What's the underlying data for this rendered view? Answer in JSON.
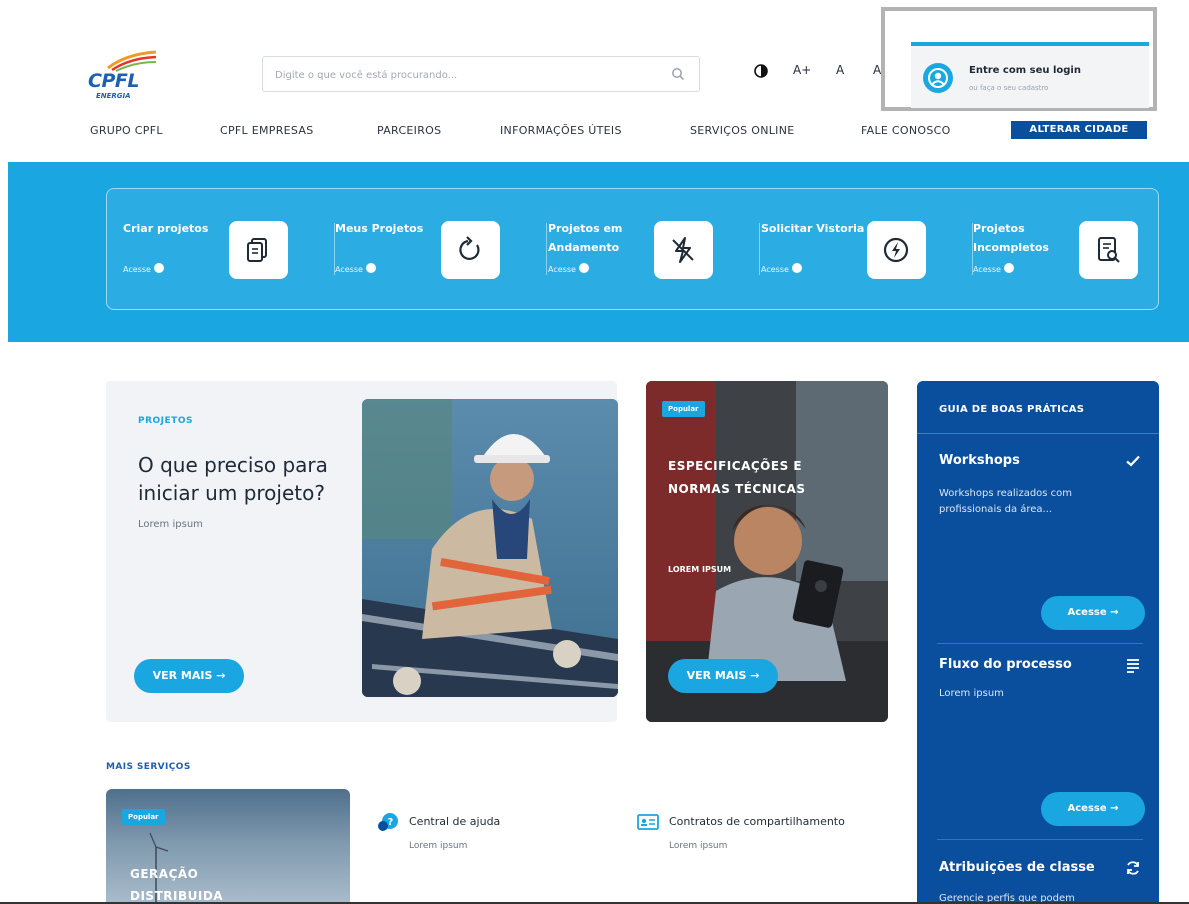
{
  "header": {
    "logo_text": "CPFL",
    "logo_sub": "ENERGIA",
    "search_placeholder": "Digite o que você está procurando...",
    "a11y": {
      "a_plus": "A+",
      "a": "A",
      "a_minus": "A-"
    },
    "login": {
      "title": "Entre com seu login",
      "subtitle": "ou faça o seu cadastro"
    }
  },
  "nav": {
    "items": [
      "GRUPO CPFL",
      "CPFL EMPRESAS",
      "PARCEIROS",
      "INFORMAÇÕES ÚTEIS",
      "SERVIÇOS ONLINE",
      "FALE CONOSCO"
    ],
    "cta": "ALTERAR CIDADE"
  },
  "actions": [
    {
      "label": "Criar projetos",
      "link": "Acesse",
      "icon": "documents-icon"
    },
    {
      "label": "Meus Projetos",
      "link": "Acesse",
      "icon": "refresh-icon"
    },
    {
      "label": "Projetos em Andamento",
      "link": "Acesse",
      "icon": "bolt-off-icon"
    },
    {
      "label": "Solicitar Vistoria",
      "link": "Acesse",
      "icon": "bolt-circle-icon"
    },
    {
      "label": "Projetos Incompletos",
      "link": "Acesse",
      "icon": "document-search-icon"
    }
  ],
  "projects": {
    "tag": "PROJETOS",
    "title": "O que preciso para iniciar um projeto?",
    "desc": "Lorem ipsum",
    "button": "VER MAIS →"
  },
  "specs": {
    "badge": "Popular",
    "title": "ESPECIFICAÇÕES E NORMAS TÉCNICAS",
    "sub": "LOREM IPSUM",
    "button": "VER MAIS →"
  },
  "guide": {
    "heading": "GUIA DE BOAS PRÁTICAS",
    "items": [
      {
        "title": "Workshops",
        "desc": "Workshops realizados com profissionais da área...",
        "button": "Acesse →",
        "icon": "check-icon"
      },
      {
        "title": "Fluxo do processo",
        "desc": "Lorem ipsum",
        "button": "Acesse →",
        "icon": "list-icon"
      },
      {
        "title": "Atribuições de classe",
        "desc": "Gerencie perfis que podem",
        "icon": "sync-icon"
      }
    ]
  },
  "more": {
    "heading": "MAIS SERVIÇOS",
    "card": {
      "badge": "Popular",
      "title": "GERAÇÃO DISTRIBUIDA"
    },
    "services": [
      {
        "title": "Central de ajuda",
        "desc": "Lorem ipsum",
        "icon": "help-chat-icon"
      },
      {
        "title": "Contratos de compartilhamento",
        "desc": "Lorem ipsum",
        "icon": "contract-card-icon"
      }
    ]
  },
  "colors": {
    "primary": "#1aa6e1",
    "navy": "#0a4f9e",
    "logo": "#1d5fb0"
  }
}
